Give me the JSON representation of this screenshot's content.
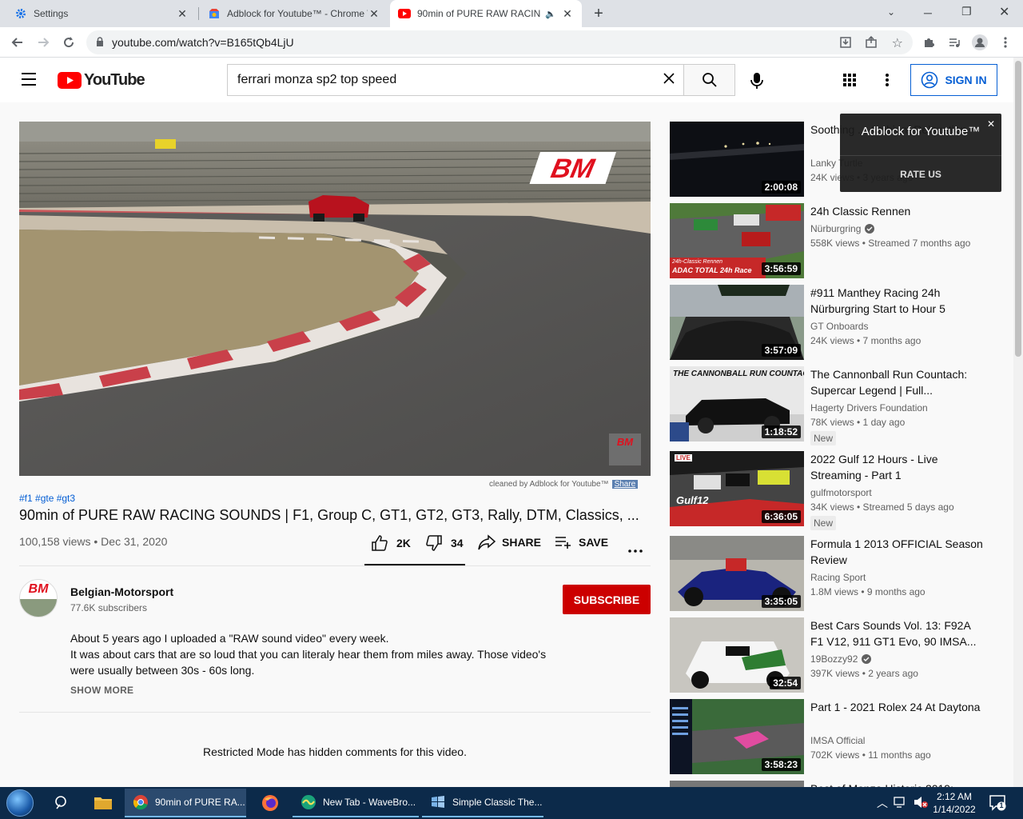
{
  "browser": {
    "tabs": [
      {
        "title": "Settings"
      },
      {
        "title": "Adblock for Youtube™ - Chrome We"
      },
      {
        "title": "90min of PURE RAW RACING"
      }
    ],
    "url": "youtube.com/watch?v=B165tQb4LjU"
  },
  "masthead": {
    "logo_text": "YouTube",
    "search_value": "ferrari monza sp2 top speed",
    "signin_label": "SIGN IN"
  },
  "player": {
    "watermark": "BM",
    "cleaned_by": "cleaned by Adblock for Youtube™",
    "share_label": "Share"
  },
  "video": {
    "hashtags": "#f1 #gte #gt3",
    "title": "90min of PURE RAW RACING SOUNDS | F1, Group C, GT1, GT2, GT3, Rally, DTM, Classics, ...",
    "views_date": "100,158 views • Dec 31, 2020",
    "likes": "2K",
    "dislikes": "34",
    "share": "SHARE",
    "save": "SAVE"
  },
  "channel": {
    "name": "Belgian-Motorsport",
    "subscribers": "77.6K subscribers",
    "subscribe_label": "SUBSCRIBE",
    "avatar_text": "BM"
  },
  "description": {
    "line1": "About 5 years ago I uploaded a \"RAW sound video\" every week.",
    "line2": "It was about cars that are so loud that you can literaly hear them from miles away. Those video's",
    "line3": "were usually between 30s - 60s long.",
    "show_more": "SHOW MORE"
  },
  "comments": {
    "restricted": "Restricted Mode has hidden comments for this video."
  },
  "popup": {
    "title": "Adblock for Youtube™",
    "rate_label": "RATE US"
  },
  "recommendations": [
    {
      "title": "Soothing ... Ambient Relaxation",
      "channel": "Lanky Turtle",
      "meta": "24K views • 3 years ago",
      "duration": "2:00:08",
      "verified": false,
      "new": ""
    },
    {
      "title": "24h Classic Rennen",
      "channel": "Nürburgring",
      "meta": "558K views • Streamed 7 months ago",
      "duration": "3:56:59",
      "verified": true,
      "new": ""
    },
    {
      "title": "#911 Manthey Racing 24h Nürburgring Start to Hour 5",
      "channel": "GT Onboards",
      "meta": "24K views • 7 months ago",
      "duration": "3:57:09",
      "verified": false,
      "new": ""
    },
    {
      "title": "The Cannonball Run Countach: Supercar Legend | Full...",
      "channel": "Hagerty Drivers Foundation",
      "meta": "78K views • 1 day ago",
      "duration": "1:18:52",
      "verified": false,
      "new": "New"
    },
    {
      "title": "2022 Gulf 12 Hours - Live Streaming - Part 1",
      "channel": "gulfmotorsport",
      "meta": "34K views • Streamed 5 days ago",
      "duration": "6:36:05",
      "verified": false,
      "new": "New"
    },
    {
      "title": "Formula 1 2013 OFFICIAL Season Review",
      "channel": "Racing Sport",
      "meta": "1.8M views • 9 months ago",
      "duration": "3:35:05",
      "verified": false,
      "new": ""
    },
    {
      "title": "Best Cars Sounds Vol. 13: F92A F1 V12, 911 GT1 Evo, 90 IMSA...",
      "channel": "19Bozzy92",
      "meta": "397K views • 2 years ago",
      "duration": "32:54",
      "verified": true,
      "new": ""
    },
    {
      "title": "Part 1 - 2021 Rolex 24 At Daytona",
      "channel": "IMSA Official",
      "meta": "702K views • 11 months ago",
      "duration": "3:58:23",
      "verified": false,
      "new": ""
    },
    {
      "title": "Best of Monza Historic 2019:",
      "channel": "",
      "meta": "",
      "duration": "",
      "verified": false,
      "new": ""
    }
  ],
  "thumb_text": {
    "t2_caption": "ADAC TOTAL 24h Race",
    "t2_small": "24h-Classic Rennen",
    "t4_caption": "THE CANNONBALL RUN COUNTACH",
    "t5_live": "LIVE",
    "t5_brand": "Gulf12"
  },
  "taskbar": {
    "items": [
      {
        "label": "90min of PURE RA..."
      },
      {
        "label": "New Tab - WaveBro..."
      },
      {
        "label": "Simple Classic The..."
      }
    ],
    "time": "2:12 AM",
    "date": "1/14/2022",
    "notif_count": "1"
  },
  "colors": {
    "youtube_red": "#ff0000",
    "link_blue": "#065fd4",
    "subscribe_red": "#cc0000"
  }
}
